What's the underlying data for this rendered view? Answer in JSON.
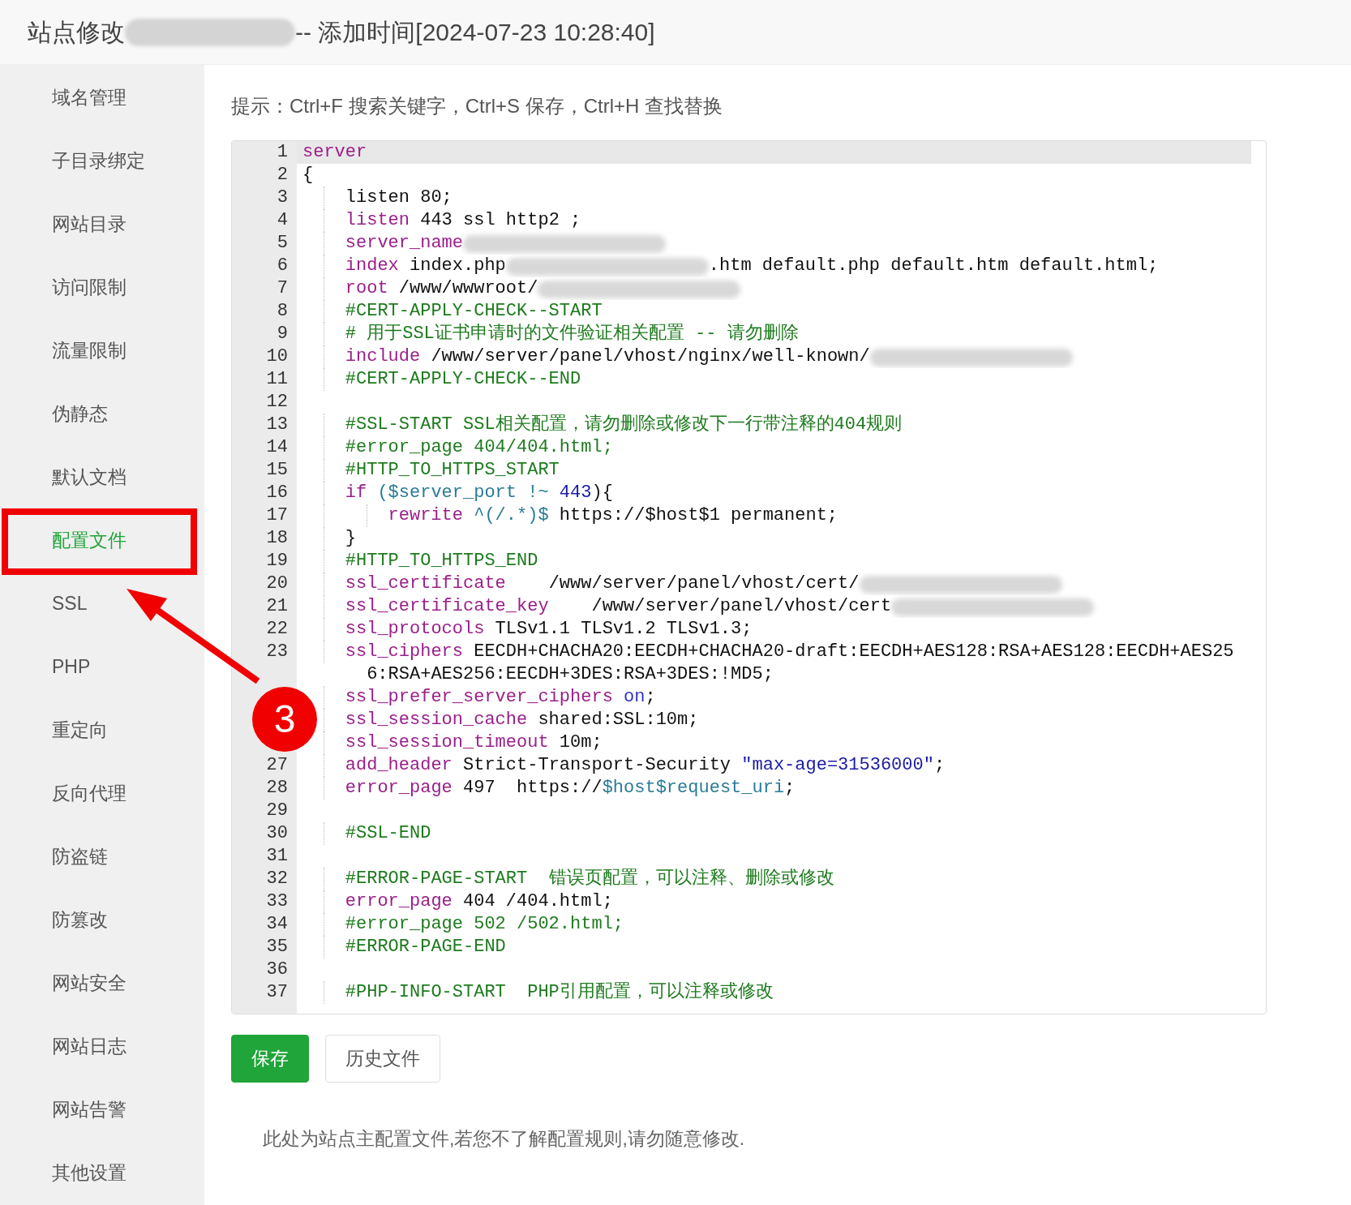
{
  "title": [
    {
      "kind": "text",
      "text": "站点修改"
    },
    {
      "kind": "redacted"
    },
    {
      "kind": "text",
      "text": "-- 添加时间[2024-07-23 10:28:40]"
    }
  ],
  "sidebar": {
    "items": [
      {
        "label": "域名管理",
        "selected": false
      },
      {
        "label": "子目录绑定",
        "selected": false
      },
      {
        "label": "网站目录",
        "selected": false
      },
      {
        "label": "访问限制",
        "selected": false
      },
      {
        "label": "流量限制",
        "selected": false
      },
      {
        "label": "伪静态",
        "selected": false
      },
      {
        "label": "默认文档",
        "selected": false
      },
      {
        "label": "配置文件",
        "selected": true
      },
      {
        "label": "SSL",
        "selected": false
      },
      {
        "label": "PHP",
        "selected": false
      },
      {
        "label": "重定向",
        "selected": false
      },
      {
        "label": "反向代理",
        "selected": false
      },
      {
        "label": "防盗链",
        "selected": false
      },
      {
        "label": "防篡改",
        "selected": false
      },
      {
        "label": "网站安全",
        "selected": false
      },
      {
        "label": "网站日志",
        "selected": false
      },
      {
        "label": "网站告警",
        "selected": false
      },
      {
        "label": "其他设置",
        "selected": false
      }
    ]
  },
  "hint": "提示：Ctrl+F 搜索关键字，Ctrl+S 保存，Ctrl+H 查找替换",
  "editor": {
    "lines": [
      {
        "number": "1",
        "current": true,
        "tokens": [
          {
            "kind": "keyword",
            "text": "server"
          }
        ]
      },
      {
        "number": "2",
        "current": false,
        "tokens": [
          {
            "kind": "plain",
            "text": "{"
          }
        ]
      },
      {
        "number": "3",
        "current": false,
        "tokens": [
          {
            "kind": "indent"
          },
          {
            "kind": "plain",
            "text": "listen 80;"
          }
        ]
      },
      {
        "number": "4",
        "current": false,
        "tokens": [
          {
            "kind": "indent"
          },
          {
            "kind": "keyword",
            "text": "listen"
          },
          {
            "kind": "plain",
            "text": " 443 ssl http2 ;"
          }
        ]
      },
      {
        "number": "5",
        "current": false,
        "tokens": [
          {
            "kind": "indent"
          },
          {
            "kind": "keyword",
            "text": "server_name"
          },
          {
            "kind": "redacted"
          }
        ]
      },
      {
        "number": "6",
        "current": false,
        "tokens": [
          {
            "kind": "indent"
          },
          {
            "kind": "keyword",
            "text": "index"
          },
          {
            "kind": "plain",
            "text": " index.php"
          },
          {
            "kind": "redacted"
          },
          {
            "kind": "plain",
            "text": ".htm default.php default.htm default.html;"
          }
        ]
      },
      {
        "number": "7",
        "current": false,
        "tokens": [
          {
            "kind": "indent"
          },
          {
            "kind": "keyword",
            "text": "root"
          },
          {
            "kind": "plain",
            "text": " /www/wwwroot/"
          },
          {
            "kind": "redacted"
          }
        ]
      },
      {
        "number": "8",
        "current": false,
        "tokens": [
          {
            "kind": "indent"
          },
          {
            "kind": "comment",
            "text": "#CERT-APPLY-CHECK--START"
          }
        ]
      },
      {
        "number": "9",
        "current": false,
        "tokens": [
          {
            "kind": "indent"
          },
          {
            "kind": "comment",
            "text": "# 用于SSL证书申请时的文件验证相关配置 -- 请勿删除"
          }
        ]
      },
      {
        "number": "10",
        "current": false,
        "tokens": [
          {
            "kind": "indent"
          },
          {
            "kind": "keyword",
            "text": "include"
          },
          {
            "kind": "plain",
            "text": " /www/server/panel/vhost/nginx/well-known/"
          },
          {
            "kind": "redacted"
          }
        ]
      },
      {
        "number": "11",
        "current": false,
        "tokens": [
          {
            "kind": "indent"
          },
          {
            "kind": "comment",
            "text": "#CERT-APPLY-CHECK--END"
          }
        ]
      },
      {
        "number": "12",
        "current": false
      },
      {
        "number": "13",
        "current": false,
        "tokens": [
          {
            "kind": "indent"
          },
          {
            "kind": "comment",
            "text": "#SSL-START SSL相关配置，请勿删除或修改下一行带注释的404规则"
          }
        ]
      },
      {
        "number": "14",
        "current": false,
        "tokens": [
          {
            "kind": "indent"
          },
          {
            "kind": "comment",
            "text": "#error_page 404/404.html;"
          }
        ]
      },
      {
        "number": "15",
        "current": false,
        "tokens": [
          {
            "kind": "indent"
          },
          {
            "kind": "comment",
            "text": "#HTTP_TO_HTTPS_START"
          }
        ]
      },
      {
        "number": "16",
        "current": false,
        "tokens": [
          {
            "kind": "indent"
          },
          {
            "kind": "keyword",
            "text": "if"
          },
          {
            "kind": "variable",
            "text": " ($server_port !~ "
          },
          {
            "kind": "number",
            "text": "443"
          },
          {
            "kind": "plain",
            "text": "){"
          }
        ]
      },
      {
        "number": "17",
        "current": false,
        "tokens": [
          {
            "kind": "indent"
          },
          {
            "kind": "indent"
          },
          {
            "kind": "keyword",
            "text": "rewrite"
          },
          {
            "kind": "variable",
            "text": " ^(/.*)$"
          },
          {
            "kind": "plain",
            "text": " https://$host$1 permanent;"
          }
        ]
      },
      {
        "number": "18",
        "current": false,
        "tokens": [
          {
            "kind": "indent"
          },
          {
            "kind": "plain",
            "text": "}"
          }
        ]
      },
      {
        "number": "19",
        "current": false,
        "tokens": [
          {
            "kind": "indent"
          },
          {
            "kind": "comment",
            "text": "#HTTP_TO_HTTPS_END"
          }
        ]
      },
      {
        "number": "20",
        "current": false,
        "tokens": [
          {
            "kind": "indent"
          },
          {
            "kind": "keyword",
            "text": "ssl_certificate"
          },
          {
            "kind": "plain",
            "text": "    /www/server/panel/vhost/cert/"
          },
          {
            "kind": "redacted"
          }
        ]
      },
      {
        "number": "21",
        "current": false,
        "tokens": [
          {
            "kind": "indent"
          },
          {
            "kind": "keyword",
            "text": "ssl_certificate_key"
          },
          {
            "kind": "plain",
            "text": "    /www/server/panel/vhost/cert"
          },
          {
            "kind": "redacted"
          }
        ]
      },
      {
        "number": "22",
        "current": false,
        "tokens": [
          {
            "kind": "indent"
          },
          {
            "kind": "keyword",
            "text": "ssl_protocols"
          },
          {
            "kind": "plain",
            "text": " TLSv1.1 TLSv1.2 TLSv1.3;"
          }
        ]
      },
      {
        "number": "23",
        "current": false,
        "tokens": [
          {
            "kind": "indent"
          },
          {
            "kind": "keyword",
            "text": "ssl_ciphers"
          },
          {
            "kind": "plain",
            "text": " EECDH+CHACHA20:EECDH+CHACHA20-draft:EECDH+AES128:RSA+AES128:EECDH+AES256:RSA+AES256:EECDH+3DES:RSA+3DES:!MD5;"
          }
        ]
      },
      {
        "current": false,
        "tokens": [
          {
            "kind": "indent"
          },
          {
            "kind": "keyword",
            "text": "ssl_prefer_server_ciphers"
          },
          {
            "kind": "atom",
            "text": " on"
          },
          {
            "kind": "plain",
            "text": ";"
          }
        ]
      },
      {
        "current": false,
        "tokens": [
          {
            "kind": "indent"
          },
          {
            "kind": "keyword",
            "text": "ssl_session_cache"
          },
          {
            "kind": "plain",
            "text": " shared:SSL:10m;"
          }
        ]
      },
      {
        "current": false,
        "tokens": [
          {
            "kind": "indent"
          },
          {
            "kind": "keyword",
            "text": "ssl_session_timeout"
          },
          {
            "kind": "plain",
            "text": " 10m;"
          }
        ]
      },
      {
        "number": "27",
        "current": false,
        "tokens": [
          {
            "kind": "indent"
          },
          {
            "kind": "keyword",
            "text": "add_header"
          },
          {
            "kind": "plain",
            "text": " Strict-Transport-Security "
          },
          {
            "kind": "string",
            "text": "\"max-age=31536000\""
          },
          {
            "kind": "plain",
            "text": ";"
          }
        ]
      },
      {
        "number": "28",
        "current": false,
        "tokens": [
          {
            "kind": "indent"
          },
          {
            "kind": "keyword",
            "text": "error_page"
          },
          {
            "kind": "plain",
            "text": " 497  https://"
          },
          {
            "kind": "variable",
            "text": "$host$request_uri"
          },
          {
            "kind": "plain",
            "text": ";"
          }
        ]
      },
      {
        "number": "29",
        "current": false
      },
      {
        "number": "30",
        "current": false,
        "tokens": [
          {
            "kind": "indent"
          },
          {
            "kind": "comment",
            "text": "#SSL-END"
          }
        ]
      },
      {
        "number": "31",
        "current": false
      },
      {
        "number": "32",
        "current": false,
        "tokens": [
          {
            "kind": "indent"
          },
          {
            "kind": "comment",
            "text": "#ERROR-PAGE-START  错误页配置，可以注释、删除或修改"
          }
        ]
      },
      {
        "number": "33",
        "current": false,
        "tokens": [
          {
            "kind": "indent"
          },
          {
            "kind": "keyword",
            "text": "error_page"
          },
          {
            "kind": "plain",
            "text": " 404 /404.html;"
          }
        ]
      },
      {
        "number": "34",
        "current": false,
        "tokens": [
          {
            "kind": "indent"
          },
          {
            "kind": "comment",
            "text": "#error_page 502 /502.html;"
          }
        ]
      },
      {
        "number": "35",
        "current": false,
        "tokens": [
          {
            "kind": "indent"
          },
          {
            "kind": "comment",
            "text": "#ERROR-PAGE-END"
          }
        ]
      },
      {
        "number": "36",
        "current": false
      },
      {
        "number": "37",
        "current": false,
        "tokens": [
          {
            "kind": "indent"
          },
          {
            "kind": "comment",
            "text": "#PHP-INFO-START  PHP引用配置，可以注释或修改"
          }
        ]
      }
    ]
  },
  "buttons": [
    {
      "kind": "primary",
      "label": "保存"
    },
    {
      "kind": "secondary",
      "label": "历史文件"
    }
  ],
  "note": "此处为站点主配置文件,若您不了解配置规则,请勿随意修改.",
  "annotation": {
    "badge": "3"
  }
}
